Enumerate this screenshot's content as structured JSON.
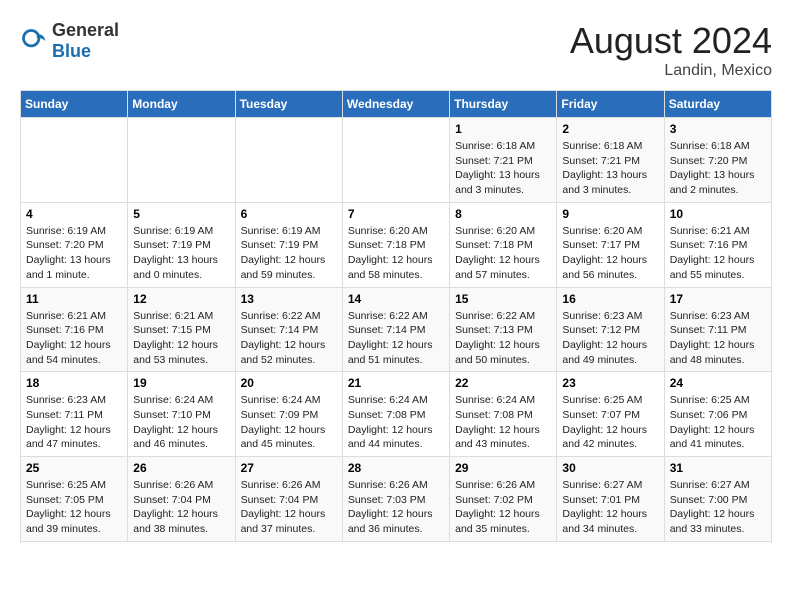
{
  "logo": {
    "general": "General",
    "blue": "Blue"
  },
  "title": "August 2024",
  "location": "Landin, Mexico",
  "days_of_week": [
    "Sunday",
    "Monday",
    "Tuesday",
    "Wednesday",
    "Thursday",
    "Friday",
    "Saturday"
  ],
  "weeks": [
    [
      {
        "day": "",
        "info": ""
      },
      {
        "day": "",
        "info": ""
      },
      {
        "day": "",
        "info": ""
      },
      {
        "day": "",
        "info": ""
      },
      {
        "day": "1",
        "info": "Sunrise: 6:18 AM\nSunset: 7:21 PM\nDaylight: 13 hours\nand 3 minutes."
      },
      {
        "day": "2",
        "info": "Sunrise: 6:18 AM\nSunset: 7:21 PM\nDaylight: 13 hours\nand 3 minutes."
      },
      {
        "day": "3",
        "info": "Sunrise: 6:18 AM\nSunset: 7:20 PM\nDaylight: 13 hours\nand 2 minutes."
      }
    ],
    [
      {
        "day": "4",
        "info": "Sunrise: 6:19 AM\nSunset: 7:20 PM\nDaylight: 13 hours\nand 1 minute."
      },
      {
        "day": "5",
        "info": "Sunrise: 6:19 AM\nSunset: 7:19 PM\nDaylight: 13 hours\nand 0 minutes."
      },
      {
        "day": "6",
        "info": "Sunrise: 6:19 AM\nSunset: 7:19 PM\nDaylight: 12 hours\nand 59 minutes."
      },
      {
        "day": "7",
        "info": "Sunrise: 6:20 AM\nSunset: 7:18 PM\nDaylight: 12 hours\nand 58 minutes."
      },
      {
        "day": "8",
        "info": "Sunrise: 6:20 AM\nSunset: 7:18 PM\nDaylight: 12 hours\nand 57 minutes."
      },
      {
        "day": "9",
        "info": "Sunrise: 6:20 AM\nSunset: 7:17 PM\nDaylight: 12 hours\nand 56 minutes."
      },
      {
        "day": "10",
        "info": "Sunrise: 6:21 AM\nSunset: 7:16 PM\nDaylight: 12 hours\nand 55 minutes."
      }
    ],
    [
      {
        "day": "11",
        "info": "Sunrise: 6:21 AM\nSunset: 7:16 PM\nDaylight: 12 hours\nand 54 minutes."
      },
      {
        "day": "12",
        "info": "Sunrise: 6:21 AM\nSunset: 7:15 PM\nDaylight: 12 hours\nand 53 minutes."
      },
      {
        "day": "13",
        "info": "Sunrise: 6:22 AM\nSunset: 7:14 PM\nDaylight: 12 hours\nand 52 minutes."
      },
      {
        "day": "14",
        "info": "Sunrise: 6:22 AM\nSunset: 7:14 PM\nDaylight: 12 hours\nand 51 minutes."
      },
      {
        "day": "15",
        "info": "Sunrise: 6:22 AM\nSunset: 7:13 PM\nDaylight: 12 hours\nand 50 minutes."
      },
      {
        "day": "16",
        "info": "Sunrise: 6:23 AM\nSunset: 7:12 PM\nDaylight: 12 hours\nand 49 minutes."
      },
      {
        "day": "17",
        "info": "Sunrise: 6:23 AM\nSunset: 7:11 PM\nDaylight: 12 hours\nand 48 minutes."
      }
    ],
    [
      {
        "day": "18",
        "info": "Sunrise: 6:23 AM\nSunset: 7:11 PM\nDaylight: 12 hours\nand 47 minutes."
      },
      {
        "day": "19",
        "info": "Sunrise: 6:24 AM\nSunset: 7:10 PM\nDaylight: 12 hours\nand 46 minutes."
      },
      {
        "day": "20",
        "info": "Sunrise: 6:24 AM\nSunset: 7:09 PM\nDaylight: 12 hours\nand 45 minutes."
      },
      {
        "day": "21",
        "info": "Sunrise: 6:24 AM\nSunset: 7:08 PM\nDaylight: 12 hours\nand 44 minutes."
      },
      {
        "day": "22",
        "info": "Sunrise: 6:24 AM\nSunset: 7:08 PM\nDaylight: 12 hours\nand 43 minutes."
      },
      {
        "day": "23",
        "info": "Sunrise: 6:25 AM\nSunset: 7:07 PM\nDaylight: 12 hours\nand 42 minutes."
      },
      {
        "day": "24",
        "info": "Sunrise: 6:25 AM\nSunset: 7:06 PM\nDaylight: 12 hours\nand 41 minutes."
      }
    ],
    [
      {
        "day": "25",
        "info": "Sunrise: 6:25 AM\nSunset: 7:05 PM\nDaylight: 12 hours\nand 39 minutes."
      },
      {
        "day": "26",
        "info": "Sunrise: 6:26 AM\nSunset: 7:04 PM\nDaylight: 12 hours\nand 38 minutes."
      },
      {
        "day": "27",
        "info": "Sunrise: 6:26 AM\nSunset: 7:04 PM\nDaylight: 12 hours\nand 37 minutes."
      },
      {
        "day": "28",
        "info": "Sunrise: 6:26 AM\nSunset: 7:03 PM\nDaylight: 12 hours\nand 36 minutes."
      },
      {
        "day": "29",
        "info": "Sunrise: 6:26 AM\nSunset: 7:02 PM\nDaylight: 12 hours\nand 35 minutes."
      },
      {
        "day": "30",
        "info": "Sunrise: 6:27 AM\nSunset: 7:01 PM\nDaylight: 12 hours\nand 34 minutes."
      },
      {
        "day": "31",
        "info": "Sunrise: 6:27 AM\nSunset: 7:00 PM\nDaylight: 12 hours\nand 33 minutes."
      }
    ]
  ]
}
